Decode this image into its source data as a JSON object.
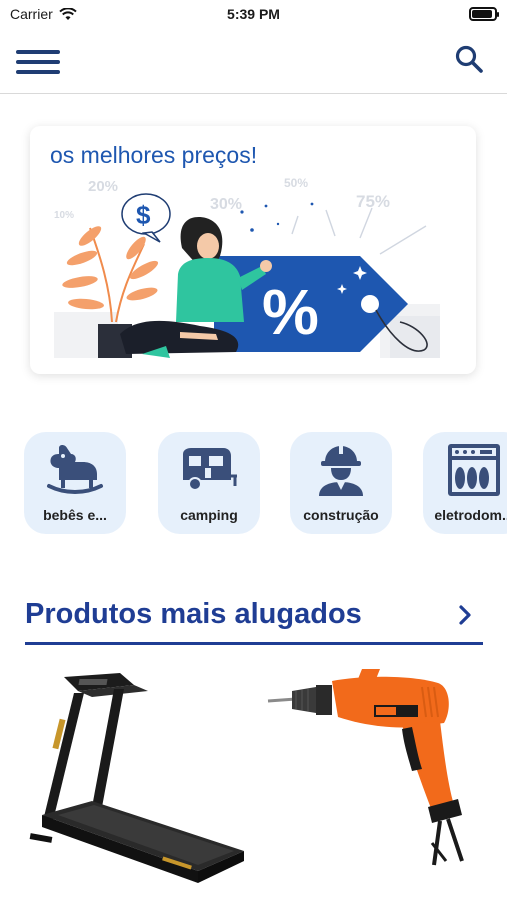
{
  "status_bar": {
    "carrier": "Carrier",
    "time": "5:39 PM",
    "battery_level": 0.9
  },
  "nav": {
    "menu_icon": "hamburger-menu-icon",
    "search_icon": "search-icon"
  },
  "banner": {
    "headline": "os melhores preços!",
    "badges": [
      "20%",
      "30%",
      "50%",
      "75%",
      "10%"
    ],
    "tag_symbol": "%",
    "bubble_symbol": "$"
  },
  "categories": [
    {
      "label": "bebês e...",
      "icon": "rocking-horse-icon"
    },
    {
      "label": "camping",
      "icon": "camper-trailer-icon"
    },
    {
      "label": "construção",
      "icon": "construction-worker-icon"
    },
    {
      "label": "eletrodom...",
      "icon": "dishwasher-icon"
    }
  ],
  "section": {
    "title": "Produtos mais alugados",
    "arrow_icon": "chevron-right-icon"
  },
  "products": [
    {
      "icon": "treadmill-image"
    },
    {
      "icon": "drill-image"
    }
  ],
  "colors": {
    "primary": "#1f3d94",
    "banner_blue": "#1e57b0",
    "category_bg": "#e6f0fb",
    "drill_orange": "#f26a1b"
  }
}
